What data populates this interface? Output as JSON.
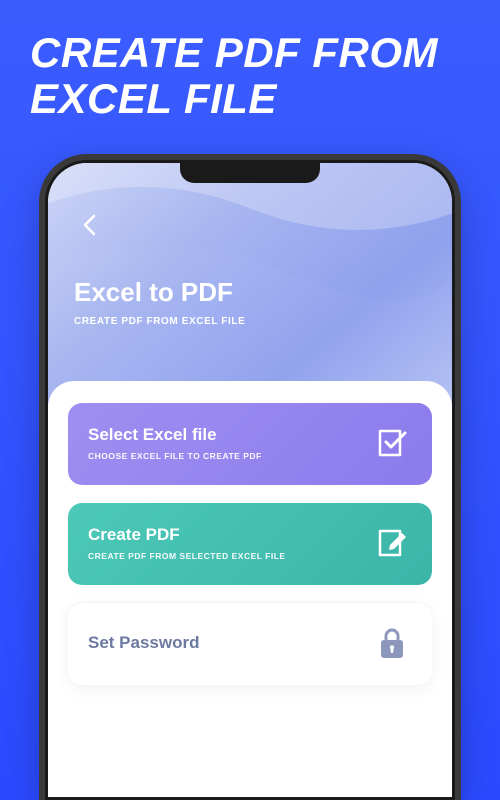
{
  "promo": {
    "headline_line1": "CREATE PDF FROM",
    "headline_line2": "EXCEL FILE"
  },
  "header": {
    "title": "Excel to PDF",
    "subtitle": "CREATE PDF FROM EXCEL FILE"
  },
  "cards": {
    "select": {
      "title": "Select Excel file",
      "subtitle": "CHOOSE EXCEL FILE TO CREATE PDF"
    },
    "create": {
      "title": "Create PDF",
      "subtitle": "CREATE PDF FROM SELECTED EXCEL FILE"
    },
    "password": {
      "title": "Set Password"
    }
  }
}
